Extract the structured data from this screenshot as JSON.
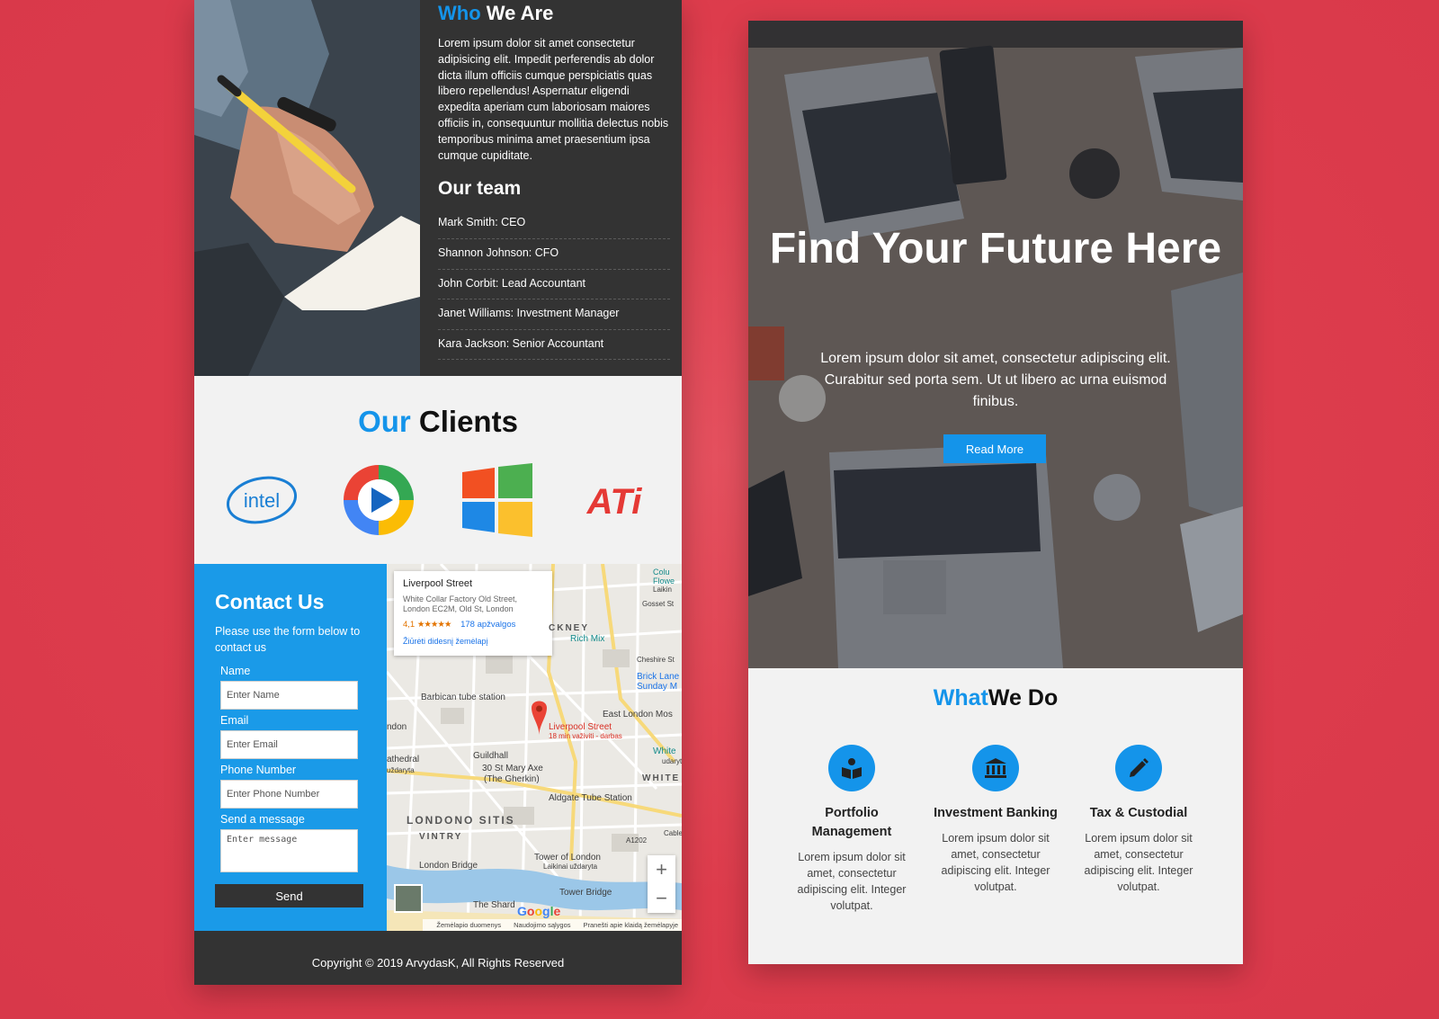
{
  "colors": {
    "background": "#dd3c4c",
    "accent": "#1494ea",
    "dark": "#333333",
    "light": "#f2f2f2"
  },
  "who": {
    "title_accent": "Who",
    "title_rest": " We Are",
    "paragraph": "Lorem ipsum dolor sit amet consectetur adipisicing elit. Impedit perferendis ab dolor dicta illum officiis cumque perspiciatis quas libero repellendus! Aspernatur eligendi expedita aperiam cum laboriosam maiores officiis in, consequuntur mollitia delectus nobis temporibus minima amet praesentium ipsa cumque cupiditate.",
    "team_title": "Our team",
    "team": [
      "Mark Smith: CEO",
      "Shannon Johnson: CFO",
      "John Corbit: Lead Accountant",
      "Janet Williams: Investment Manager",
      "Kara Jackson: Senior Accountant"
    ]
  },
  "clients": {
    "title_accent": "Our",
    "title_rest": " Clients",
    "logos": [
      "intel-logo",
      "media-player-logo",
      "windows-logo",
      "ati-logo"
    ],
    "intel_text": "intel",
    "ati_text": "ATi"
  },
  "contact": {
    "title": "Contact Us",
    "subtitle": "Please use the form below to contact us",
    "name_label": "Name",
    "name_placeholder": "Enter Name",
    "email_label": "Email",
    "email_placeholder": "Enter Email",
    "phone_label": "Phone Number",
    "phone_placeholder": "Enter Phone Number",
    "message_label": "Send a message",
    "message_placeholder": "Enter message",
    "send_label": "Send"
  },
  "map": {
    "place_title": "Liverpool Street",
    "place_address": "White Collar Factory Old Street, London EC2M, Old St, London",
    "rating": "4,1",
    "stars": "★★★★★",
    "reviews": "178 apžvalgos",
    "bigger_map": "Žiūrėti didesnį žemėlapį",
    "labels": {
      "barbican": "Barbican tube station",
      "liverpool": "Liverpool Street",
      "liverpool_sub": "18 min važiviti - darbas",
      "guildhall": "Guildhall",
      "mary_axe": "30 St Mary Axe",
      "gherkin": "(The Gherkin)",
      "aldgate": "Aldgate Tube Station",
      "londono_sitis": "LONDONO SITIS",
      "vintry": "VINTRY",
      "london_bridge": "London Bridge",
      "tower_of_london": "Tower of London",
      "tower_sub": "Laikinai uždaryta",
      "tower_bridge": "Tower Bridge",
      "the_shard": "The Shard",
      "rich_mix": "Rich Mix",
      "brick_lane": "Brick Lane",
      "sunday": "Sunday M",
      "east_london": "East London Mos",
      "whitechapel": "WHITE",
      "shoreditch": "CKNEY",
      "gosset": "Gosset St",
      "cheshire": "Cheshire St",
      "cathedral": "athedral",
      "cathedral_sub": "uždaryta",
      "london_left": "ndon",
      "white_right": "White",
      "a1202": "A1202",
      "cable": "Cable",
      "columbia": "Colu",
      "flower": "Flowe",
      "laikina": "Laikin",
      "udarytas": "udarytas"
    },
    "zoom_in": "+",
    "zoom_out": "−",
    "google": "Google",
    "footer_data": "Žemėlapio duomenys",
    "footer_terms": "Naudojimo sąlygos",
    "footer_report": "Pranešti apie klaidą žemėlapyje"
  },
  "left_footer": {
    "copyright": "Copyright © 2019 ArvydasK, All Rights Reserved"
  },
  "hero": {
    "title": "Find Your Future Here",
    "subtitle": "Lorem ipsum dolor sit amet, consectetur adipiscing elit. Curabitur sed porta sem. Ut ut libero ac urna euismod finibus.",
    "button": "Read More"
  },
  "what": {
    "title_accent": "What",
    "title_rest": "We Do",
    "services": [
      {
        "icon": "book-reader-icon",
        "title": "Portfolio Management",
        "text": "Lorem ipsum dolor sit amet, consectetur adipiscing elit. Integer volutpat."
      },
      {
        "icon": "bank-icon",
        "title": "Investment Banking",
        "text": "Lorem ipsum dolor sit amet, consectetur adipiscing elit. Integer volutpat."
      },
      {
        "icon": "pencil-icon",
        "title": "Tax & Custodial",
        "text": "Lorem ipsum dolor sit amet, consectetur adipiscing elit. Integer volutpat."
      }
    ]
  }
}
